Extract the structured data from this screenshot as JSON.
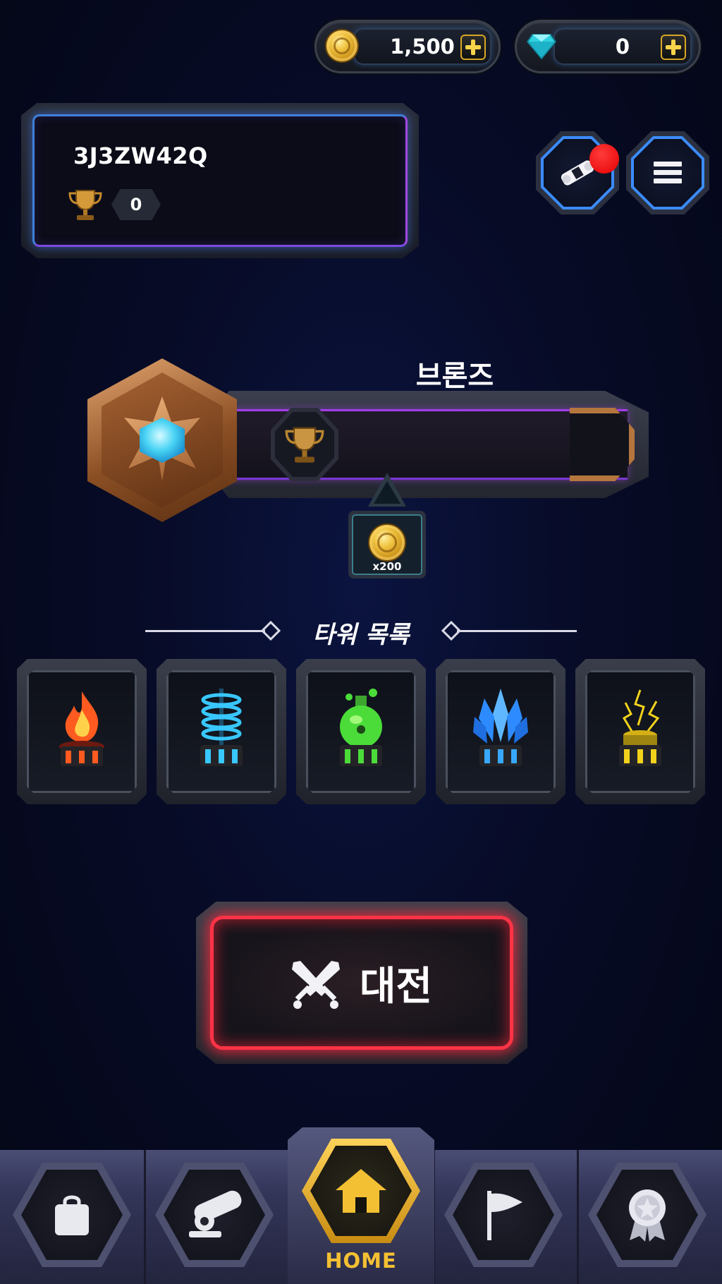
{
  "currency": {
    "gold": {
      "icon": "gold-coin-icon",
      "value": "1,500",
      "add_icon": "plus-icon"
    },
    "gems": {
      "icon": "diamond-icon",
      "value": "0",
      "add_icon": "plus-icon"
    }
  },
  "profile": {
    "player_id": "3J3ZW42Q",
    "trophy_icon": "trophy-icon",
    "trophies": "0"
  },
  "top_buttons": [
    {
      "icon": "ticket-scroll-icon",
      "has_notification": true
    },
    {
      "icon": "hamburger-menu-icon"
    }
  ],
  "rank": {
    "tier": "브론즈",
    "emblem": "bronze-rank-emblem",
    "progress": 0,
    "next_reward": {
      "icon": "gold-coin-icon",
      "quantity": "x200"
    }
  },
  "towers": {
    "title": "타워 목록",
    "items": [
      {
        "name": "fire-tower",
        "accent": "#ff5a1f"
      },
      {
        "name": "water-tower",
        "accent": "#38c7ff"
      },
      {
        "name": "poison-tower",
        "accent": "#4bdc3a"
      },
      {
        "name": "ice-crystal-tower",
        "accent": "#2e8bff"
      },
      {
        "name": "lightning-tower",
        "accent": "#f2d21b"
      }
    ]
  },
  "battle_button": {
    "label": "대전",
    "icon": "crossed-swords-icon",
    "color": "#ff3346"
  },
  "bottom_nav": {
    "items": [
      {
        "id": "shop",
        "icon": "shopping-bag-icon"
      },
      {
        "id": "towers",
        "icon": "cannon-icon"
      },
      {
        "id": "home",
        "icon": "home-icon",
        "label": "HOME",
        "active": true
      },
      {
        "id": "clan",
        "icon": "flag-icon"
      },
      {
        "id": "ranking",
        "icon": "medal-icon"
      }
    ],
    "active_color": "#f4c033"
  }
}
